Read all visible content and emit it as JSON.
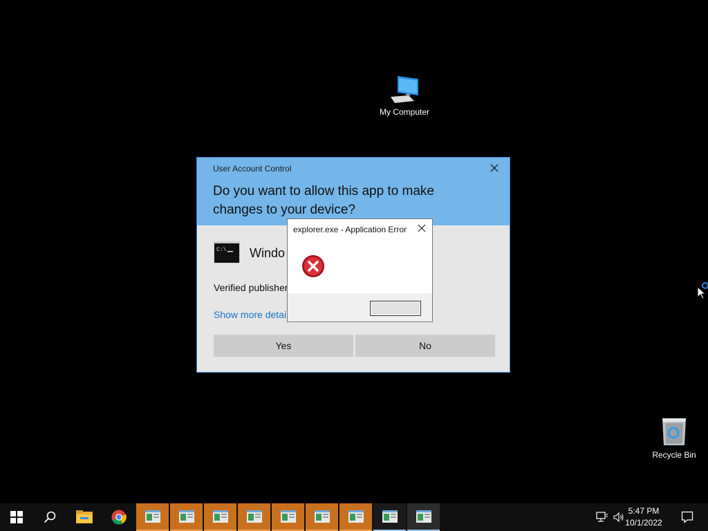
{
  "desktop": {
    "icons": [
      {
        "label": "My Computer",
        "icon": "computer-icon"
      },
      {
        "label": "Recycle Bin",
        "icon": "recycle-bin-icon"
      }
    ]
  },
  "uac": {
    "title": "User Account Control",
    "question": "Do you want to allow this app to make changes to your device?",
    "app_name": "Windo",
    "publisher": "Verified publisher",
    "details_link": "Show more detai",
    "yes_label": "Yes",
    "no_label": "No"
  },
  "app_error": {
    "title": "explorer.exe - Application Error",
    "ok_label": ""
  },
  "taskbar": {
    "items": [
      "start-icon",
      "search-icon",
      "file-explorer-icon",
      "chrome-icon",
      "app-window-icon"
    ],
    "clock_time": "5:47 PM",
    "clock_date": "10/1/2022"
  },
  "colors": {
    "uac_header": "#74b6ea",
    "uac_body": "#e6e6e6",
    "taskbar_app_flashing": "#c9701f",
    "link": "#1a73c8"
  }
}
